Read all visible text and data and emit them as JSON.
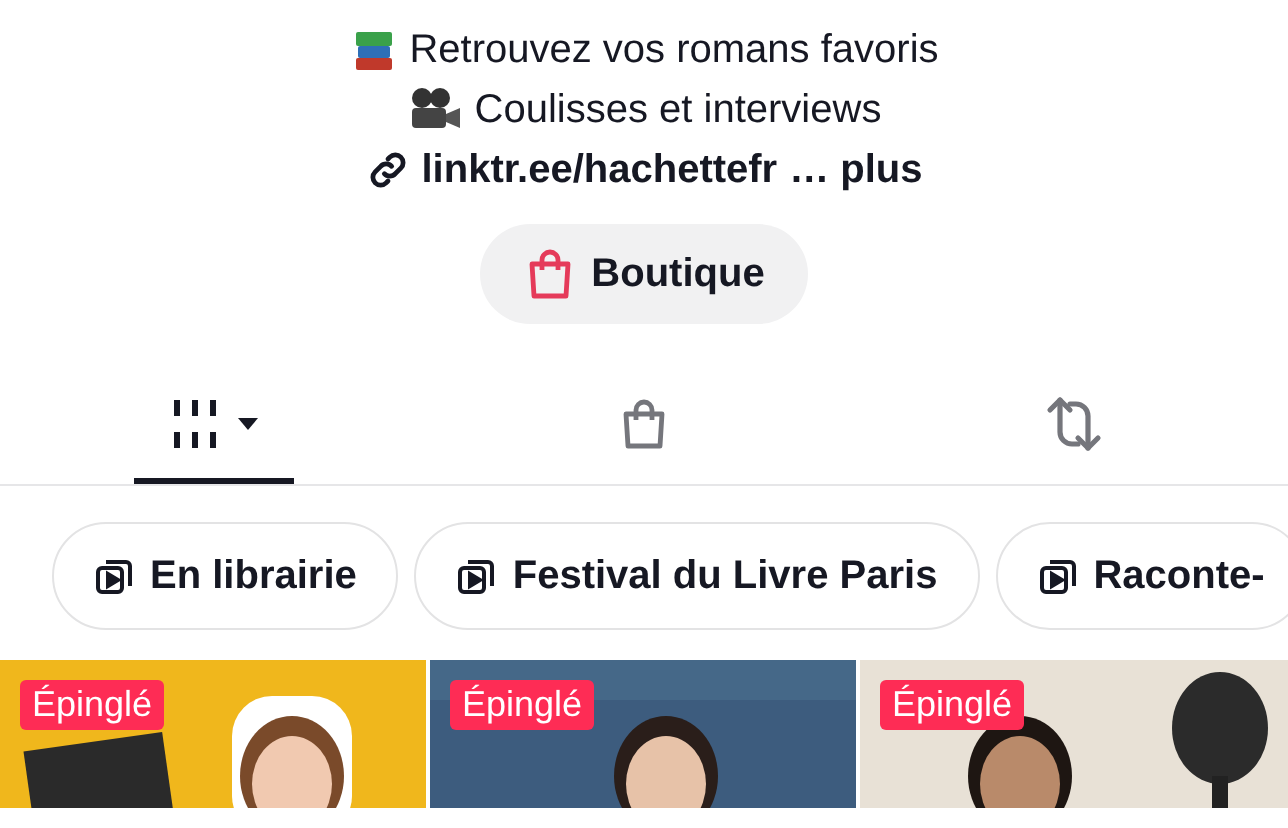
{
  "bio": [
    {
      "kind": "books",
      "text": "Retrouvez vos romans favoris"
    },
    {
      "kind": "camera",
      "text": "Coulisses et interviews"
    }
  ],
  "link": {
    "url": "linktr.ee/hachettefr",
    "more": "… plus"
  },
  "shop_button": {
    "label": "Boutique"
  },
  "tabs": [
    {
      "kind": "videos",
      "selected": true
    },
    {
      "kind": "shop",
      "selected": false
    },
    {
      "kind": "reposts",
      "selected": false
    }
  ],
  "playlists": [
    {
      "label": "En librairie"
    },
    {
      "label": "Festival du Livre Paris"
    },
    {
      "label": "Raconte-"
    }
  ],
  "videos": [
    {
      "kind": "picture",
      "badge": "Épinglé"
    },
    {
      "kind": "picture",
      "badge": "Épinglé"
    },
    {
      "kind": "picture",
      "badge": "Épinglé"
    }
  ]
}
